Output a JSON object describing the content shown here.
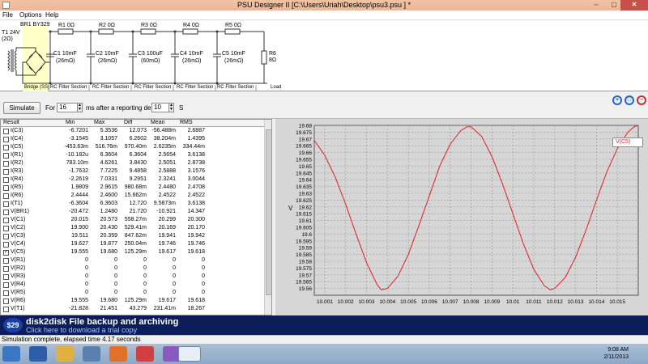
{
  "window": {
    "title": "PSU Designer II  [C:\\Users\\Uriah\\Desktop\\psu3.psu ] *",
    "minimize": "–",
    "maximize": "▢",
    "close": "✕"
  },
  "menu": [
    "File",
    "Options",
    "Help"
  ],
  "schematic": {
    "transformer": [
      "T1 24V",
      "(2Ω)"
    ],
    "bridge_label": "BR1 BY329",
    "bridge_caption": "Bridge (SS)",
    "resistors": [
      "R1 0Ω",
      "R2 0Ω",
      "R3 0Ω",
      "R4 0Ω",
      "R5 0Ω"
    ],
    "caps": [
      {
        "name": "C1 10mF",
        "esr": "(26mΩ)"
      },
      {
        "name": "C2 10mF",
        "esr": "(26mΩ)"
      },
      {
        "name": "C3 100uF",
        "esr": "(60mΩ)"
      },
      {
        "name": "C4 10mF",
        "esr": "(26mΩ)"
      },
      {
        "name": "C5 10mF",
        "esr": "(26mΩ)"
      }
    ],
    "load": {
      "name": "R6",
      "value": "8Ω"
    },
    "section_labels": [
      "RC Filter Section",
      "RC Filter Section",
      "RC Filter Section",
      "RC Filter Section",
      "RC Filter Section"
    ],
    "load_caption": "Load"
  },
  "controls": {
    "simulate": "Simulate",
    "for_label": "For",
    "duration": "16",
    "ms_label": "ms  after a reporting delay of",
    "delay": "10",
    "s_label": "S"
  },
  "table": {
    "headers": [
      "Result",
      "Min",
      "Max",
      "Diff",
      "Mean",
      "RMS"
    ],
    "rows": [
      {
        "name": "I(C3)",
        "checked": false,
        "values": [
          "-6.7201",
          "5.3536",
          "12.073",
          "-56.488m",
          "2.6887"
        ]
      },
      {
        "name": "I(C4)",
        "checked": false,
        "values": [
          "-3.1545",
          "3.1057",
          "6.2602",
          "38.204m",
          "1.4395"
        ]
      },
      {
        "name": "I(C5)",
        "checked": false,
        "values": [
          "-453.63m",
          "516.76m",
          "970.40m",
          "2.6235m",
          "334.44m"
        ]
      },
      {
        "name": "I(R1)",
        "checked": false,
        "values": [
          "-10.182u",
          "6.3604",
          "6.3604",
          "2.5654",
          "3.6138"
        ]
      },
      {
        "name": "I(R2)",
        "checked": false,
        "values": [
          "783.10m",
          "4.6261",
          "3.8430",
          "2.5051",
          "2.8738"
        ]
      },
      {
        "name": "I(R3)",
        "checked": false,
        "values": [
          "-1.7632",
          "7.7225",
          "9.4858",
          "2.5888",
          "3.1576"
        ]
      },
      {
        "name": "I(R4)",
        "checked": false,
        "values": [
          "-2.2619",
          "7.0331",
          "9.2951",
          "2.3241",
          "3.0044"
        ]
      },
      {
        "name": "I(R5)",
        "checked": false,
        "values": [
          "1.9809",
          "2.9615",
          "980.68m",
          "2.4480",
          "2.4708"
        ]
      },
      {
        "name": "I(R6)",
        "checked": false,
        "values": [
          "2.4444",
          "2.4600",
          "15.662m",
          "2.4522",
          "2.4522"
        ]
      },
      {
        "name": "I(T1)",
        "checked": false,
        "values": [
          "-6.3604",
          "6.3603",
          "12.720",
          "9.5873m",
          "3.6138"
        ]
      },
      {
        "name": "V(BR1)",
        "checked": false,
        "values": [
          "-20.472",
          "1.2480",
          "21.720",
          "-10.921",
          "14.347"
        ]
      },
      {
        "name": "V(C1)",
        "checked": false,
        "values": [
          "20.015",
          "20.573",
          "558.27m",
          "20.299",
          "20.300"
        ]
      },
      {
        "name": "V(C2)",
        "checked": false,
        "values": [
          "19.900",
          "20.430",
          "529.41m",
          "20.169",
          "20.170"
        ]
      },
      {
        "name": "V(C3)",
        "checked": false,
        "values": [
          "19.511",
          "20.359",
          "847.62m",
          "19.941",
          "19.942"
        ]
      },
      {
        "name": "V(C4)",
        "checked": false,
        "values": [
          "19.627",
          "19.877",
          "250.04m",
          "19.746",
          "19.746"
        ]
      },
      {
        "name": "V(C5)",
        "checked": true,
        "values": [
          "19.555",
          "19.680",
          "125.29m",
          "19.617",
          "19.618"
        ]
      },
      {
        "name": "V(R1)",
        "checked": false,
        "values": [
          "0",
          "0",
          "0",
          "0",
          "0"
        ]
      },
      {
        "name": "V(R2)",
        "checked": false,
        "values": [
          "0",
          "0",
          "0",
          "0",
          "0"
        ]
      },
      {
        "name": "V(R3)",
        "checked": false,
        "values": [
          "0",
          "0",
          "0",
          "0",
          "0"
        ]
      },
      {
        "name": "V(R4)",
        "checked": false,
        "values": [
          "0",
          "0",
          "0",
          "0",
          "0"
        ]
      },
      {
        "name": "V(R5)",
        "checked": false,
        "values": [
          "0",
          "0",
          "0",
          "0",
          "0"
        ]
      },
      {
        "name": "V(R6)",
        "checked": false,
        "values": [
          "19.555",
          "19.680",
          "125.29m",
          "19.617",
          "19.618"
        ]
      },
      {
        "name": "V(T1)",
        "checked": false,
        "values": [
          "-21.828",
          "21.451",
          "43.279",
          "231.41m",
          "18.267"
        ]
      }
    ]
  },
  "chart_data": {
    "type": "line",
    "ylabel": "V",
    "xlabel": "",
    "ylim": [
      19.555,
      19.68
    ],
    "xlim": [
      10.0005,
      10.016
    ],
    "yticks": [
      "19.68",
      "19.675",
      "19.67",
      "19.665",
      "19.66",
      "19.655",
      "19.65",
      "19.645",
      "19.64",
      "19.635",
      "19.63",
      "19.625",
      "19.62",
      "19.615",
      "19.61",
      "19.605",
      "19.6",
      "19.595",
      "19.59",
      "19.585",
      "19.58",
      "19.575",
      "19.57",
      "19.565",
      "19.56"
    ],
    "xticks": [
      "10.001",
      "10.002",
      "10.003",
      "10.004",
      "10.005",
      "10.006",
      "10.007",
      "10.008",
      "10.009",
      "10.01",
      "10.011",
      "10.012",
      "10.013",
      "10.014",
      "10.015"
    ],
    "grid": true,
    "legend": "right",
    "series": [
      {
        "name": "V(C5)",
        "color": "#e02020",
        "x": [
          10.0005,
          10.001,
          10.0015,
          10.002,
          10.0025,
          10.003,
          10.0035,
          10.0037,
          10.004,
          10.0045,
          10.005,
          10.0055,
          10.006,
          10.0065,
          10.007,
          10.0075,
          10.0078,
          10.008,
          10.0085,
          10.009,
          10.0095,
          10.01,
          10.0105,
          10.011,
          10.0115,
          10.0118,
          10.012,
          10.0125,
          10.013,
          10.0135,
          10.014,
          10.0145,
          10.015,
          10.0155,
          10.0158,
          10.016
        ],
        "y": [
          19.669,
          19.658,
          19.642,
          19.622,
          19.6,
          19.579,
          19.563,
          19.559,
          19.56,
          19.569,
          19.585,
          19.606,
          19.628,
          19.65,
          19.666,
          19.676,
          19.679,
          19.679,
          19.672,
          19.657,
          19.637,
          19.615,
          19.593,
          19.574,
          19.562,
          19.559,
          19.56,
          19.568,
          19.583,
          19.603,
          19.625,
          19.646,
          19.663,
          19.675,
          19.679,
          19.68
        ]
      }
    ]
  },
  "banner": {
    "badge": "$29",
    "headline": "disk2disk File backup and archiving",
    "subline": "Click here to download a trial copy"
  },
  "status": "Simulation complete, elapsed time 4.17 seconds",
  "taskbar": {
    "time": "9:08 AM",
    "date": "2/11/2013"
  }
}
